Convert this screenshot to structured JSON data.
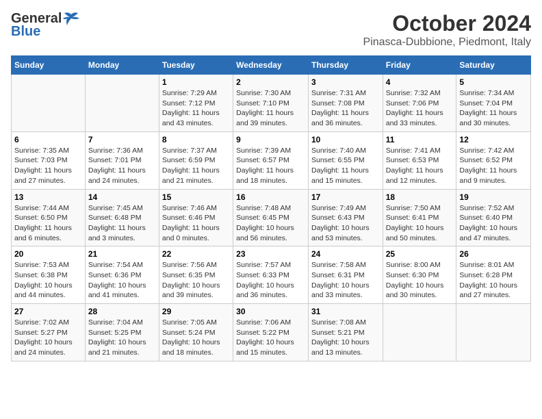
{
  "header": {
    "logo_general": "General",
    "logo_blue": "Blue",
    "title": "October 2024",
    "subtitle": "Pinasca-Dubbione, Piedmont, Italy"
  },
  "days_of_week": [
    "Sunday",
    "Monday",
    "Tuesday",
    "Wednesday",
    "Thursday",
    "Friday",
    "Saturday"
  ],
  "weeks": [
    [
      {
        "day": "",
        "content": ""
      },
      {
        "day": "",
        "content": ""
      },
      {
        "day": "1",
        "content": "Sunrise: 7:29 AM\nSunset: 7:12 PM\nDaylight: 11 hours and 43 minutes."
      },
      {
        "day": "2",
        "content": "Sunrise: 7:30 AM\nSunset: 7:10 PM\nDaylight: 11 hours and 39 minutes."
      },
      {
        "day": "3",
        "content": "Sunrise: 7:31 AM\nSunset: 7:08 PM\nDaylight: 11 hours and 36 minutes."
      },
      {
        "day": "4",
        "content": "Sunrise: 7:32 AM\nSunset: 7:06 PM\nDaylight: 11 hours and 33 minutes."
      },
      {
        "day": "5",
        "content": "Sunrise: 7:34 AM\nSunset: 7:04 PM\nDaylight: 11 hours and 30 minutes."
      }
    ],
    [
      {
        "day": "6",
        "content": "Sunrise: 7:35 AM\nSunset: 7:03 PM\nDaylight: 11 hours and 27 minutes."
      },
      {
        "day": "7",
        "content": "Sunrise: 7:36 AM\nSunset: 7:01 PM\nDaylight: 11 hours and 24 minutes."
      },
      {
        "day": "8",
        "content": "Sunrise: 7:37 AM\nSunset: 6:59 PM\nDaylight: 11 hours and 21 minutes."
      },
      {
        "day": "9",
        "content": "Sunrise: 7:39 AM\nSunset: 6:57 PM\nDaylight: 11 hours and 18 minutes."
      },
      {
        "day": "10",
        "content": "Sunrise: 7:40 AM\nSunset: 6:55 PM\nDaylight: 11 hours and 15 minutes."
      },
      {
        "day": "11",
        "content": "Sunrise: 7:41 AM\nSunset: 6:53 PM\nDaylight: 11 hours and 12 minutes."
      },
      {
        "day": "12",
        "content": "Sunrise: 7:42 AM\nSunset: 6:52 PM\nDaylight: 11 hours and 9 minutes."
      }
    ],
    [
      {
        "day": "13",
        "content": "Sunrise: 7:44 AM\nSunset: 6:50 PM\nDaylight: 11 hours and 6 minutes."
      },
      {
        "day": "14",
        "content": "Sunrise: 7:45 AM\nSunset: 6:48 PM\nDaylight: 11 hours and 3 minutes."
      },
      {
        "day": "15",
        "content": "Sunrise: 7:46 AM\nSunset: 6:46 PM\nDaylight: 11 hours and 0 minutes."
      },
      {
        "day": "16",
        "content": "Sunrise: 7:48 AM\nSunset: 6:45 PM\nDaylight: 10 hours and 56 minutes."
      },
      {
        "day": "17",
        "content": "Sunrise: 7:49 AM\nSunset: 6:43 PM\nDaylight: 10 hours and 53 minutes."
      },
      {
        "day": "18",
        "content": "Sunrise: 7:50 AM\nSunset: 6:41 PM\nDaylight: 10 hours and 50 minutes."
      },
      {
        "day": "19",
        "content": "Sunrise: 7:52 AM\nSunset: 6:40 PM\nDaylight: 10 hours and 47 minutes."
      }
    ],
    [
      {
        "day": "20",
        "content": "Sunrise: 7:53 AM\nSunset: 6:38 PM\nDaylight: 10 hours and 44 minutes."
      },
      {
        "day": "21",
        "content": "Sunrise: 7:54 AM\nSunset: 6:36 PM\nDaylight: 10 hours and 41 minutes."
      },
      {
        "day": "22",
        "content": "Sunrise: 7:56 AM\nSunset: 6:35 PM\nDaylight: 10 hours and 39 minutes."
      },
      {
        "day": "23",
        "content": "Sunrise: 7:57 AM\nSunset: 6:33 PM\nDaylight: 10 hours and 36 minutes."
      },
      {
        "day": "24",
        "content": "Sunrise: 7:58 AM\nSunset: 6:31 PM\nDaylight: 10 hours and 33 minutes."
      },
      {
        "day": "25",
        "content": "Sunrise: 8:00 AM\nSunset: 6:30 PM\nDaylight: 10 hours and 30 minutes."
      },
      {
        "day": "26",
        "content": "Sunrise: 8:01 AM\nSunset: 6:28 PM\nDaylight: 10 hours and 27 minutes."
      }
    ],
    [
      {
        "day": "27",
        "content": "Sunrise: 7:02 AM\nSunset: 5:27 PM\nDaylight: 10 hours and 24 minutes."
      },
      {
        "day": "28",
        "content": "Sunrise: 7:04 AM\nSunset: 5:25 PM\nDaylight: 10 hours and 21 minutes."
      },
      {
        "day": "29",
        "content": "Sunrise: 7:05 AM\nSunset: 5:24 PM\nDaylight: 10 hours and 18 minutes."
      },
      {
        "day": "30",
        "content": "Sunrise: 7:06 AM\nSunset: 5:22 PM\nDaylight: 10 hours and 15 minutes."
      },
      {
        "day": "31",
        "content": "Sunrise: 7:08 AM\nSunset: 5:21 PM\nDaylight: 10 hours and 13 minutes."
      },
      {
        "day": "",
        "content": ""
      },
      {
        "day": "",
        "content": ""
      }
    ]
  ]
}
